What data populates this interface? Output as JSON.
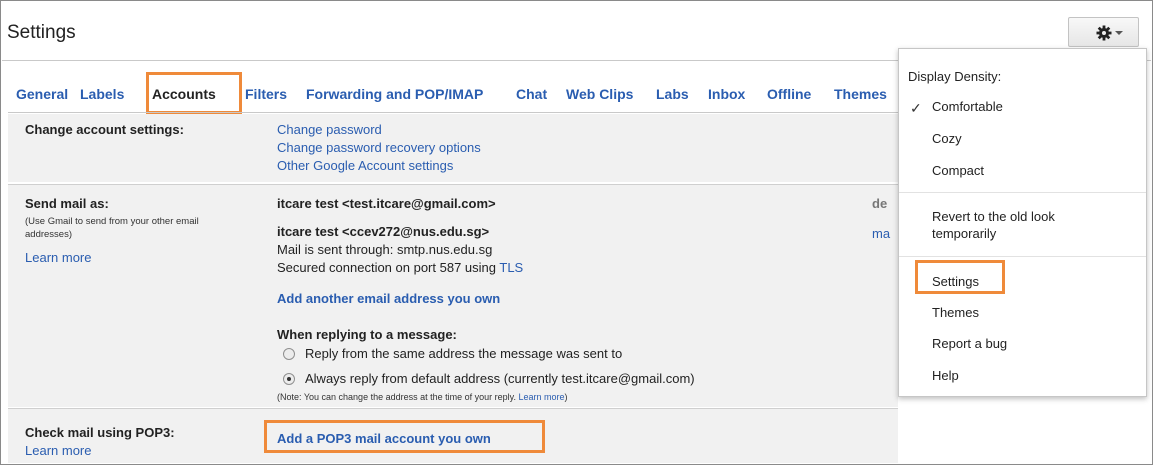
{
  "title": "Settings",
  "tabs": [
    "General",
    "Labels",
    "Accounts",
    "Filters",
    "Forwarding and POP/IMAP",
    "Chat",
    "Web Clips",
    "Labs",
    "Inbox",
    "Offline",
    "Themes"
  ],
  "active_tab": "Accounts",
  "change_account": {
    "label": "Change account settings:",
    "links": [
      "Change password",
      "Change password recovery options",
      "Other Google Account settings"
    ]
  },
  "send_mail": {
    "label": "Send mail as:",
    "hint": "(Use Gmail to send from your other email addresses)",
    "learn_more": "Learn more",
    "addr1": "itcare test <test.itcare@gmail.com>",
    "addr1_action": "de",
    "addr2": "itcare test <ccev272@nus.edu.sg>",
    "addr2_action": "ma",
    "sent_through": "Mail is sent through: smtp.nus.edu.sg",
    "secured": "Secured connection on port 587 using",
    "tls": "TLS",
    "add_another": "Add another email address you own",
    "replying_head": "When replying to a message:",
    "reply_same": "Reply from the same address the message was sent to",
    "reply_default": "Always reply from default address (currently test.itcare@gmail.com)",
    "note_prefix": "(Note: You can change the address at the time of your reply.",
    "note_link": "Learn more",
    "note_suffix": ")"
  },
  "check_mail": {
    "label": "Check mail using POP3:",
    "learn_more": "Learn more",
    "add_pop3": "Add a POP3 mail account you own"
  },
  "menu": {
    "density_head": "Display Density:",
    "comfortable": "Comfortable",
    "cozy": "Cozy",
    "compact": "Compact",
    "revert": "Revert to the old look temporarily",
    "settings": "Settings",
    "themes": "Themes",
    "report_bug": "Report a bug",
    "help": "Help"
  },
  "icons": {
    "gear": "gear-icon",
    "caret": "chevron-down-icon",
    "check": "check-icon"
  },
  "colors": {
    "link": "#2a5db0",
    "highlight": "#ef8a3a",
    "shade": "#f1f1f1"
  }
}
